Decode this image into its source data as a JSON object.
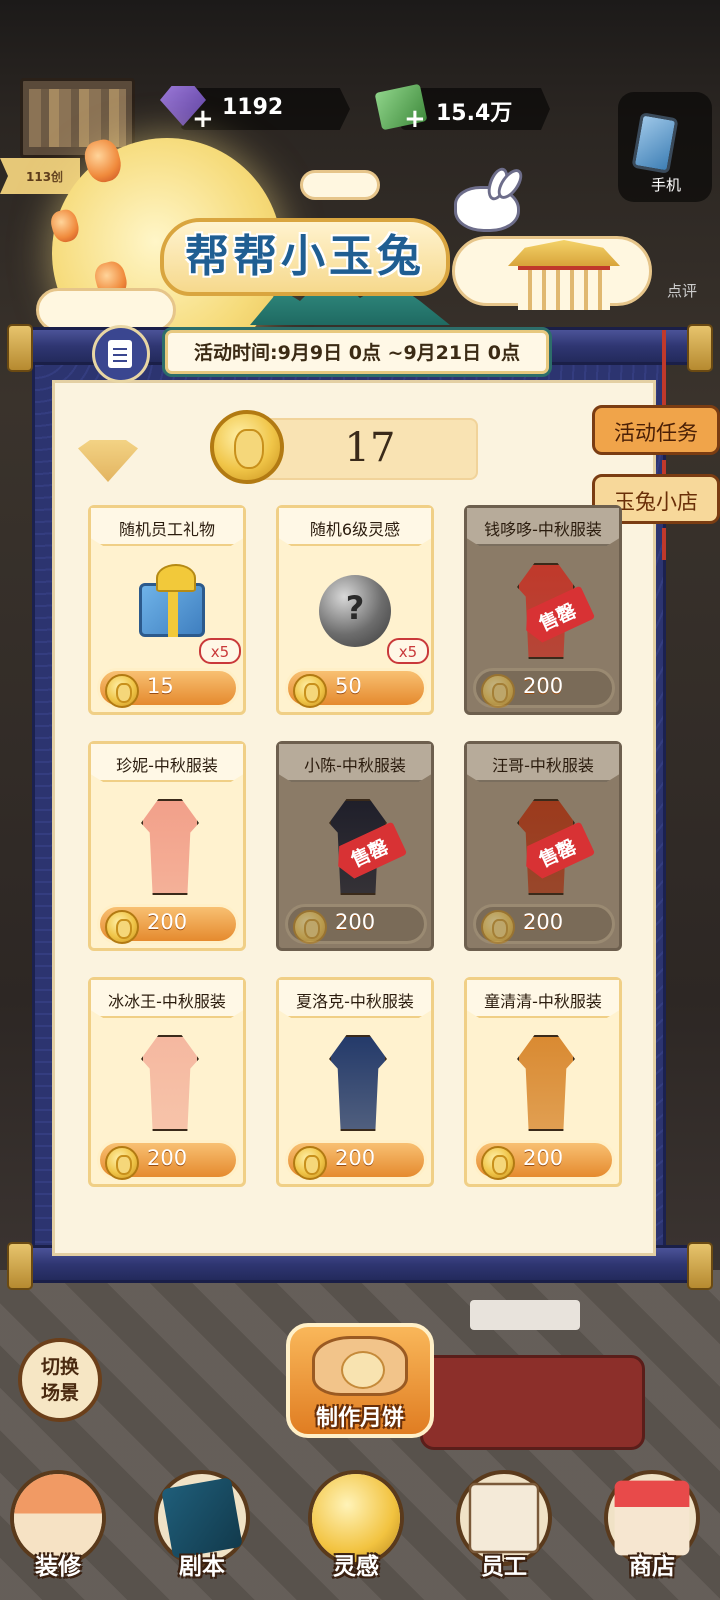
{
  "hud": {
    "gems": "1192",
    "cash": "15.4万",
    "left_tag": "113创",
    "phone_label": "手机",
    "review_label": "点评"
  },
  "event": {
    "title": "帮帮小玉兔",
    "time_label": "活动时间:9月9日 0点 ~9月21日 0点",
    "coin_balance": "17"
  },
  "side_tabs": [
    {
      "label": "活动任务",
      "active": false
    },
    {
      "label": "玉兔小店",
      "active": true
    }
  ],
  "shop_items": [
    {
      "name": "随机员工礼物",
      "price": "15",
      "qty": "x5",
      "sold_out": false,
      "icon": "gift-box-icon"
    },
    {
      "name": "随机6级灵感",
      "price": "50",
      "qty": "x5",
      "sold_out": false,
      "icon": "mystery-orb-icon",
      "glyph": "?"
    },
    {
      "name": "钱哆哆-中秋服装",
      "price": "200",
      "sold_out": true,
      "sold_label": "售罄",
      "icon": "robe-icon",
      "color": "#c0392b"
    },
    {
      "name": "珍妮-中秋服装",
      "price": "200",
      "sold_out": false,
      "icon": "robe-icon",
      "color": "#f2a08a"
    },
    {
      "name": "小陈-中秋服装",
      "price": "200",
      "sold_out": true,
      "sold_label": "售罄",
      "icon": "robe-icon",
      "color": "#1f1f2a"
    },
    {
      "name": "汪哥-中秋服装",
      "price": "200",
      "sold_out": true,
      "sold_label": "售罄",
      "icon": "robe-icon",
      "color": "#9c3a1c"
    },
    {
      "name": "冰冰王-中秋服装",
      "price": "200",
      "sold_out": false,
      "icon": "robe-icon",
      "color": "#f5b8a0"
    },
    {
      "name": "夏洛克-中秋服装",
      "price": "200",
      "sold_out": false,
      "icon": "robe-icon",
      "color": "#243a6a"
    },
    {
      "name": "童清清-中秋服装",
      "price": "200",
      "sold_out": false,
      "icon": "robe-icon",
      "color": "#d98a32"
    }
  ],
  "bottom": {
    "switch_scene": "切换场景",
    "make_mooncake": "制作月饼",
    "nav": [
      {
        "label": "装修",
        "icon": "house-icon"
      },
      {
        "label": "剧本",
        "icon": "script-book-icon"
      },
      {
        "label": "灵感",
        "icon": "inspiration-bulb-icon"
      },
      {
        "label": "员工",
        "icon": "staff-badge-icon"
      },
      {
        "label": "商店",
        "icon": "shop-icon"
      }
    ]
  }
}
